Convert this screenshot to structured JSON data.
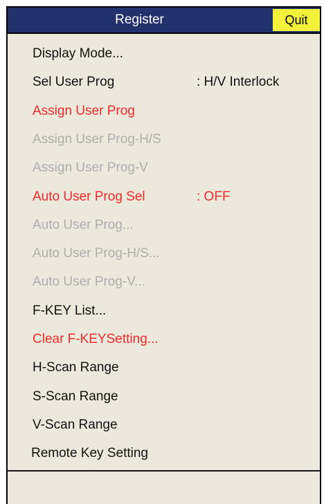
{
  "header": {
    "title": "Register",
    "quit_label": "Quit"
  },
  "colors": {
    "panel_bg": "#ece9dc",
    "title_bg": "#22306b",
    "quit_bg": "#f2f23a",
    "highlight_text": "#ee2a2a",
    "disabled_text": "#aeaeae"
  },
  "menu": {
    "items": [
      {
        "label": "Display Mode...",
        "value": "",
        "state": "enabled"
      },
      {
        "label": "Sel User Prog",
        "value": ": H/V Interlock",
        "state": "enabled"
      },
      {
        "label": "Assign User Prog",
        "value": "",
        "state": "highlight"
      },
      {
        "label": "Assign User Prog-H/S",
        "value": "",
        "state": "disabled"
      },
      {
        "label": "Assign User Prog-V",
        "value": "",
        "state": "disabled"
      },
      {
        "label": "Auto User Prog Sel",
        "value": ": OFF",
        "state": "highlight"
      },
      {
        "label": "Auto User Prog...",
        "value": "",
        "state": "disabled"
      },
      {
        "label": "Auto User Prog-H/S...",
        "value": "",
        "state": "disabled"
      },
      {
        "label": "Auto User Prog-V...",
        "value": "",
        "state": "disabled"
      },
      {
        "label": "F-KEY List...",
        "value": "",
        "state": "enabled"
      },
      {
        "label": "Clear F-KEYSetting...",
        "value": "",
        "state": "highlight"
      },
      {
        "label": "H-Scan Range",
        "value": "",
        "state": "enabled"
      },
      {
        "label": "S-Scan Range",
        "value": "",
        "state": "enabled"
      },
      {
        "label": "V-Scan Range",
        "value": "",
        "state": "enabled"
      },
      {
        "label": "Remote Key Setting",
        "value": "",
        "state": "enabled"
      }
    ]
  }
}
